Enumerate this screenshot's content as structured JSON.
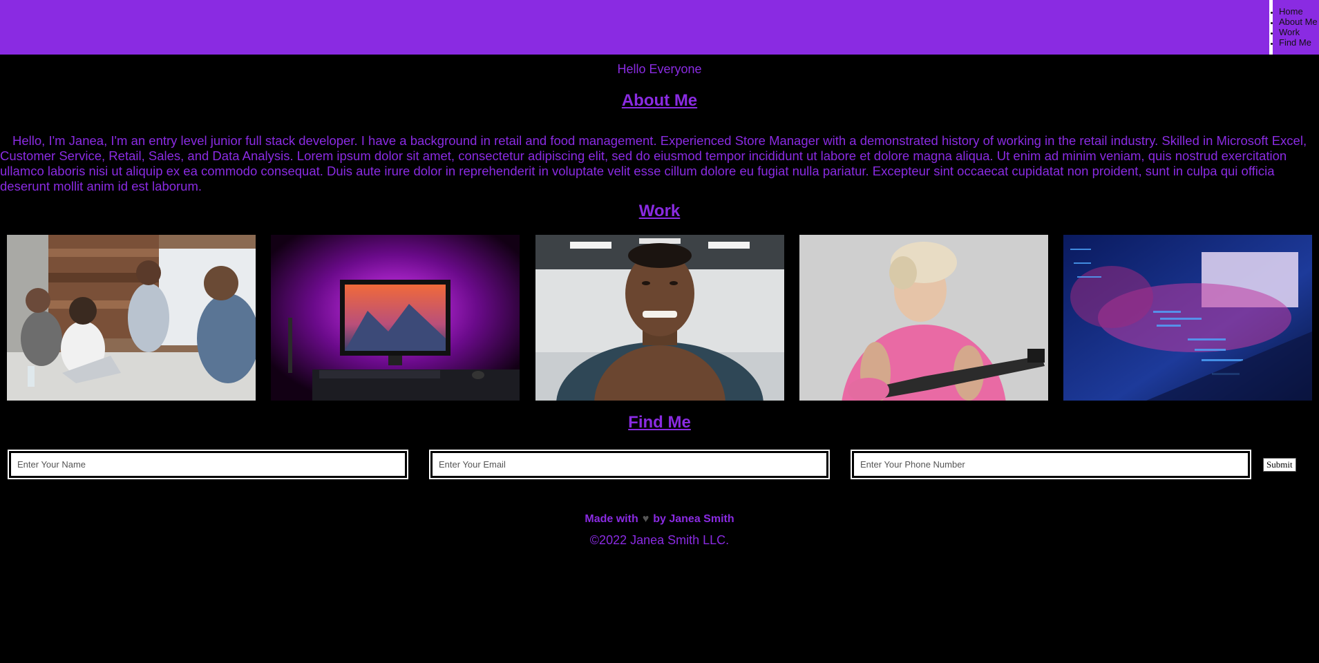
{
  "nav": {
    "items": [
      {
        "label": "Home"
      },
      {
        "label": "About Me"
      },
      {
        "label": "Work"
      },
      {
        "label": "Find Me"
      }
    ]
  },
  "greeting": "Hello Everyone",
  "about": {
    "heading": "About Me",
    "text": "Hello, I'm Janea, I'm an entry level junior full stack developer. I have a background in retail and food management. Experienced Store Manager with a demonstrated history of working in the retail industry. Skilled in Microsoft Excel, Customer Service, Retail, Sales, and Data Analysis. Lorem ipsum dolor sit amet, consectetur adipiscing elit, sed do eiusmod tempor incididunt ut labore et dolore magna aliqua. Ut enim ad minim veniam, quis nostrud exercitation ullamco laboris nisi ut aliquip ex ea commodo consequat. Duis aute irure dolor in reprehenderit in voluptate velit esse cillum dolore eu fugiat nulla pariatur. Excepteur sint occaecat cupidatat non proident, sunt in culpa qui officia deserunt mollit anim id est laborum."
  },
  "work": {
    "heading": "Work"
  },
  "find_me": {
    "heading": "Find Me",
    "name_placeholder": "Enter Your Name",
    "email_placeholder": "Enter Your Email",
    "phone_placeholder": "Enter Your Phone Number",
    "submit_label": "Submit"
  },
  "footer": {
    "made_with": "Made with",
    "by": "by Janea Smith",
    "copyright": "©2022 Janea Smith LLC."
  },
  "colors": {
    "accent": "#8a2be2",
    "background": "#000000"
  }
}
